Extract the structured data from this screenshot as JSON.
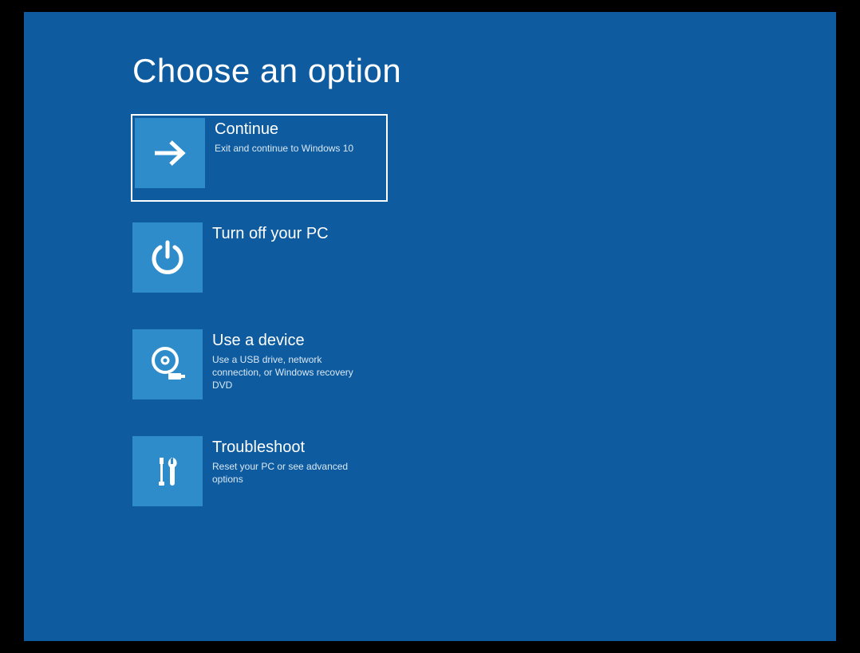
{
  "title": "Choose an option",
  "options": [
    {
      "id": "continue",
      "title": "Continue",
      "desc": "Exit and continue to Windows 10",
      "selected": true
    },
    {
      "id": "turn-off",
      "title": "Turn off your PC",
      "desc": ""
    },
    {
      "id": "use-device",
      "title": "Use a device",
      "desc": "Use a USB drive, network connection, or Windows recovery DVD"
    },
    {
      "id": "troubleshoot",
      "title": "Troubleshoot",
      "desc": "Reset your PC or see advanced options"
    }
  ],
  "colors": {
    "background": "#0e5c9f",
    "tile": "#2f8ccb",
    "text": "#ffffff"
  }
}
